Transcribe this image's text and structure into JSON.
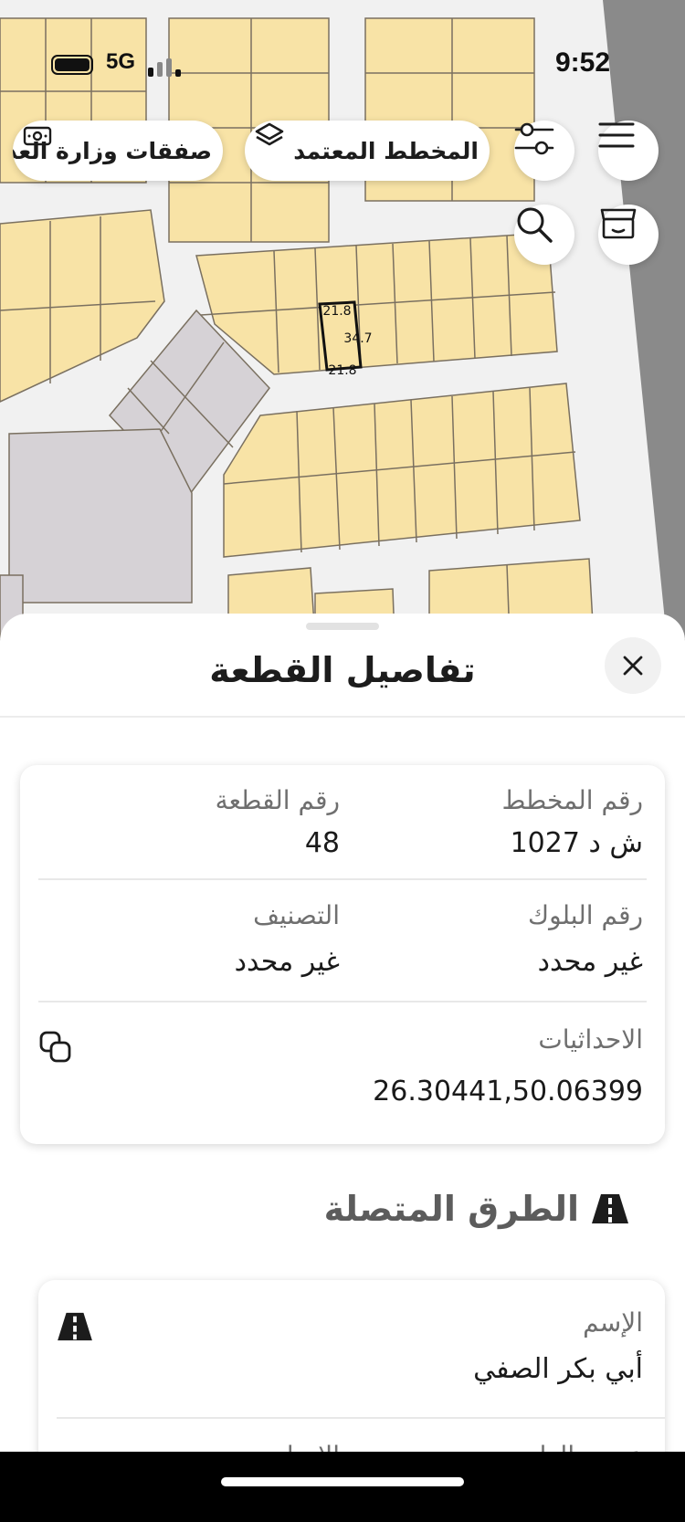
{
  "status_bar": {
    "time": "9:52",
    "network": "5G"
  },
  "map": {
    "plot_labels": {
      "top_edge": "21.8",
      "side_edge": "34.7",
      "bottom_edge": "21.8"
    },
    "chips": {
      "approved_plan": "المخطط المعتمد",
      "ministry_deals": "صفقات وزارة العدل"
    },
    "icons": {
      "menu": "hamburger-menu-icon",
      "filter": "sliders-icon",
      "store": "storefront-icon",
      "search": "search-icon",
      "layers": "layers-icon",
      "deals": "money-exchange-icon"
    }
  },
  "sheet": {
    "title": "تفاصيل القطعة",
    "details": {
      "plan_number_label": "رقم المخطط",
      "plan_number_value": "ش د 1027",
      "plot_number_label": "رقم القطعة",
      "plot_number_value": "48",
      "block_number_label": "رقم البلوك",
      "block_number_value": "غير محدد",
      "classification_label": "التصنيف",
      "classification_value": "غير محدد",
      "coordinates_label": "الاحداثيات",
      "coordinates_value": "26.30441,50.06399"
    },
    "connected_roads": {
      "title": "الطرق المتصلة",
      "road": {
        "name_label": "الإسم",
        "name_value": "أبي بكر الصفي",
        "width_label": "عرض الطريق",
        "direction_label": "الاتجاه"
      }
    }
  },
  "colors": {
    "plot_fill": "#f8e3a6",
    "plot_stroke": "#7a7060",
    "road": "#f1f1f1",
    "grey_block": "#d6d2d6",
    "accent_dark": "#1c1c1c"
  }
}
